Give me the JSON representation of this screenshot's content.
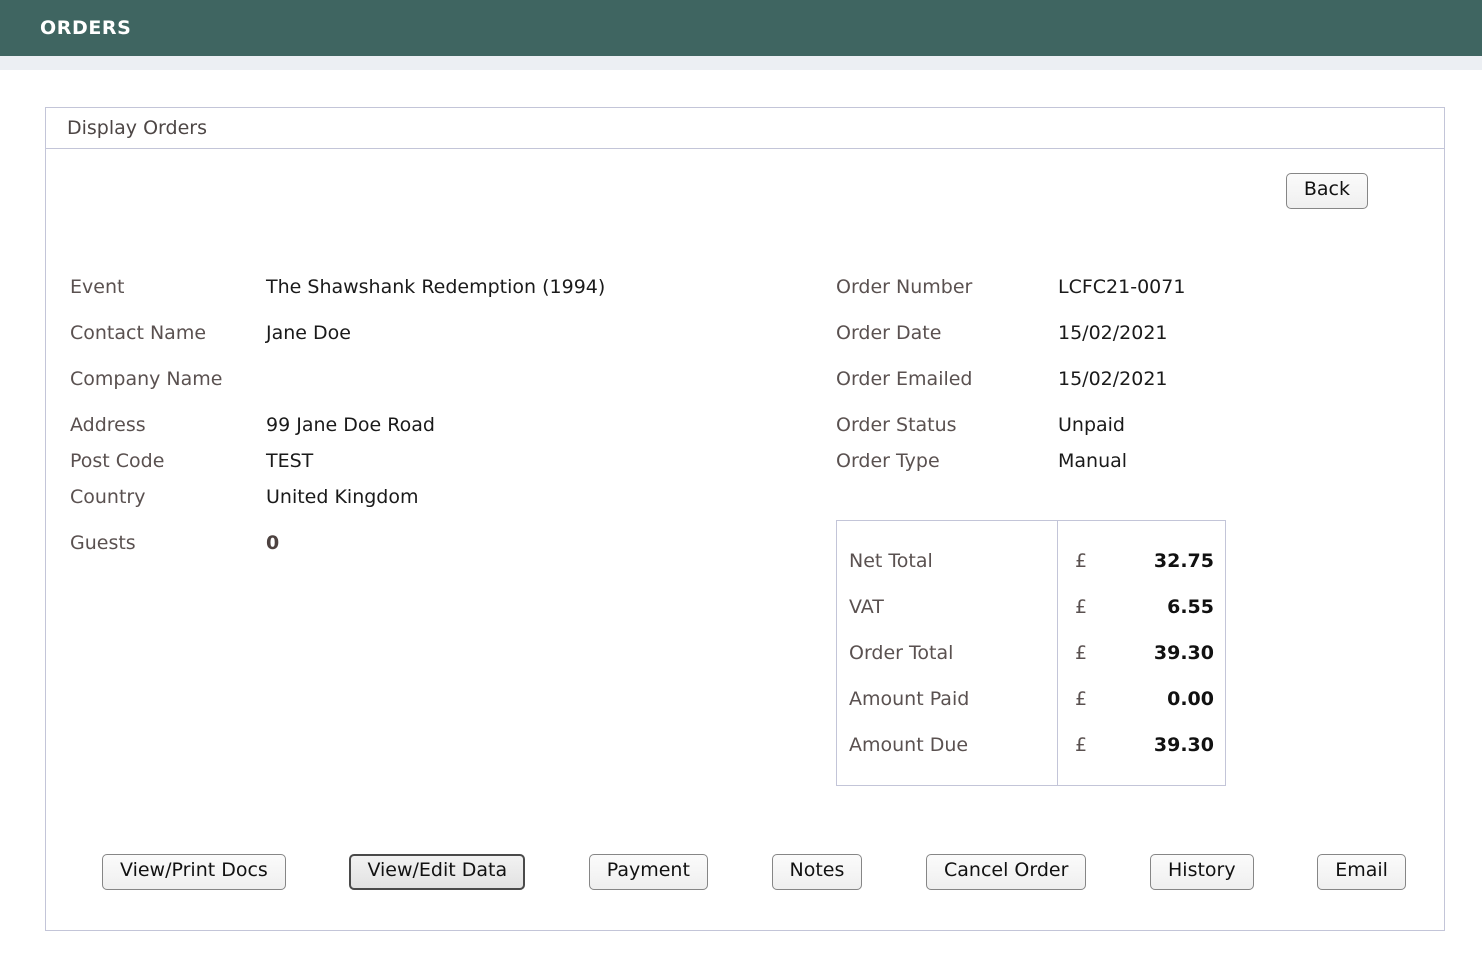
{
  "topbar": {
    "title": "ORDERS"
  },
  "panel": {
    "header_title": "Display Orders"
  },
  "back_button": {
    "label": "Back"
  },
  "order_details_left": [
    {
      "label": "Event",
      "value": "The Shawshank Redemption (1994)",
      "bold": false
    },
    {
      "label": "Contact Name",
      "value": "Jane Doe",
      "bold": false
    },
    {
      "label": "Company Name",
      "value": "",
      "bold": false
    },
    {
      "label": "Address",
      "value": "99 Jane Doe Road",
      "bold": false
    },
    {
      "label": "Post Code",
      "value": "TEST",
      "bold": false
    },
    {
      "label": "Country",
      "value": "United Kingdom",
      "bold": false
    },
    {
      "label": "Guests",
      "value": "0",
      "bold": true
    }
  ],
  "order_details_right": [
    {
      "label": "Order Number",
      "value": "LCFC21-0071"
    },
    {
      "label": "Order Date",
      "value": "15/02/2021"
    },
    {
      "label": "Order Emailed",
      "value": "15/02/2021"
    },
    {
      "label": "Order Status",
      "value": "Unpaid"
    },
    {
      "label": "Order Type",
      "value": "Manual"
    }
  ],
  "totals": {
    "currency_symbol": "£",
    "rows": [
      {
        "label": "Net Total",
        "amount": "32.75"
      },
      {
        "label": "VAT",
        "amount": "6.55"
      },
      {
        "label": "Order Total",
        "amount": "39.30"
      },
      {
        "label": "Amount Paid",
        "amount": "0.00"
      },
      {
        "label": "Amount Due",
        "amount": "39.30"
      }
    ]
  },
  "action_buttons": [
    {
      "label": "View/Print Docs",
      "focused": false
    },
    {
      "label": "View/Edit Data",
      "focused": true
    },
    {
      "label": "Payment",
      "focused": false
    },
    {
      "label": "Notes",
      "focused": false
    },
    {
      "label": "Cancel Order",
      "focused": false
    },
    {
      "label": "History",
      "focused": false
    },
    {
      "label": "Email",
      "focused": false
    }
  ],
  "colors": {
    "header_teal": "#3f6561",
    "panel_border": "#c3c5d8",
    "label_text": "#5a5150",
    "value_text": "#1a1a1a",
    "subbar": "#eceff3"
  }
}
